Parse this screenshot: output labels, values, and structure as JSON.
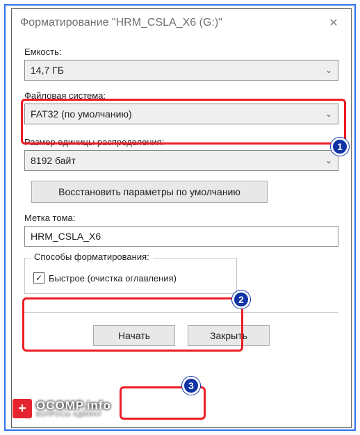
{
  "title": "Форматирование \"HRM_CSLA_X6 (G:)\"",
  "labels": {
    "capacity": "Емкость:",
    "filesystem": "Файловая система:",
    "allocation": "Размер единицы распределения:",
    "volume": "Метка тома:",
    "formatOptions": "Способы форматирования:"
  },
  "values": {
    "capacity": "14,7 ГБ",
    "filesystem": "FAT32 (по умолчанию)",
    "allocation": "8192 байт",
    "volume": "HRM_CSLA_X6"
  },
  "restoreDefaults": "Восстановить параметры по умолчанию",
  "quickFormat": "Быстрое (очистка оглавления)",
  "buttons": {
    "start": "Начать",
    "close": "Закрыть"
  },
  "markers": {
    "m1": "1",
    "m2": "2",
    "m3": "3"
  },
  "watermark": {
    "main": "OCOMP.info",
    "sub": "ВОПРОСЫ АДМИНУ"
  },
  "check": "✓",
  "chevron": "⌄",
  "xmark": "✕",
  "plus": "+"
}
